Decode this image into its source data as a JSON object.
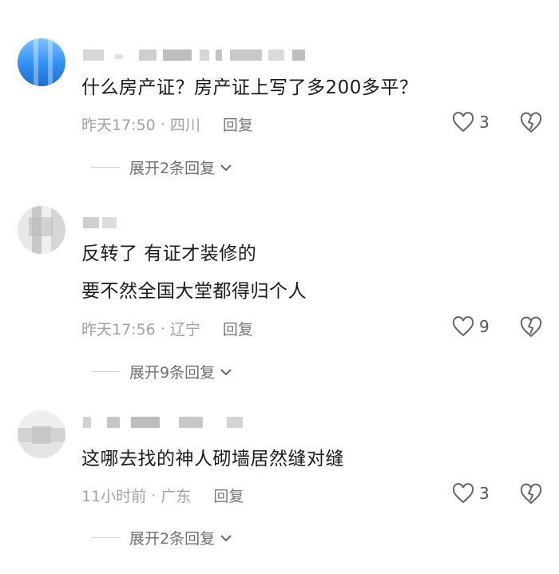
{
  "comments": [
    {
      "text_lines": [
        "什么房产证？房产证上写了多200多平？"
      ],
      "time": "昨天17:50",
      "location": "四川",
      "reply_label": "回复",
      "likes": "3",
      "expand_label": "展开2条回复"
    },
    {
      "text_lines": [
        "反转了 有证才装修的",
        "要不然全国大堂都得归个人"
      ],
      "time": "昨天17:56",
      "location": "辽宁",
      "reply_label": "回复",
      "likes": "9",
      "expand_label": "展开9条回复"
    },
    {
      "text_lines": [
        "这哪去找的神人砌墙居然缝对缝"
      ],
      "time": "11小时前",
      "location": "广东",
      "reply_label": "回复",
      "likes": "3",
      "expand_label": "展开2条回复"
    }
  ],
  "icons": {
    "like": "heart-outline-icon",
    "dislike": "broken-heart-icon",
    "expand": "chevron-down-icon"
  },
  "colors": {
    "text": "#1a1a1a",
    "meta": "#a2a2a2",
    "reply": "#7a7a7a"
  }
}
